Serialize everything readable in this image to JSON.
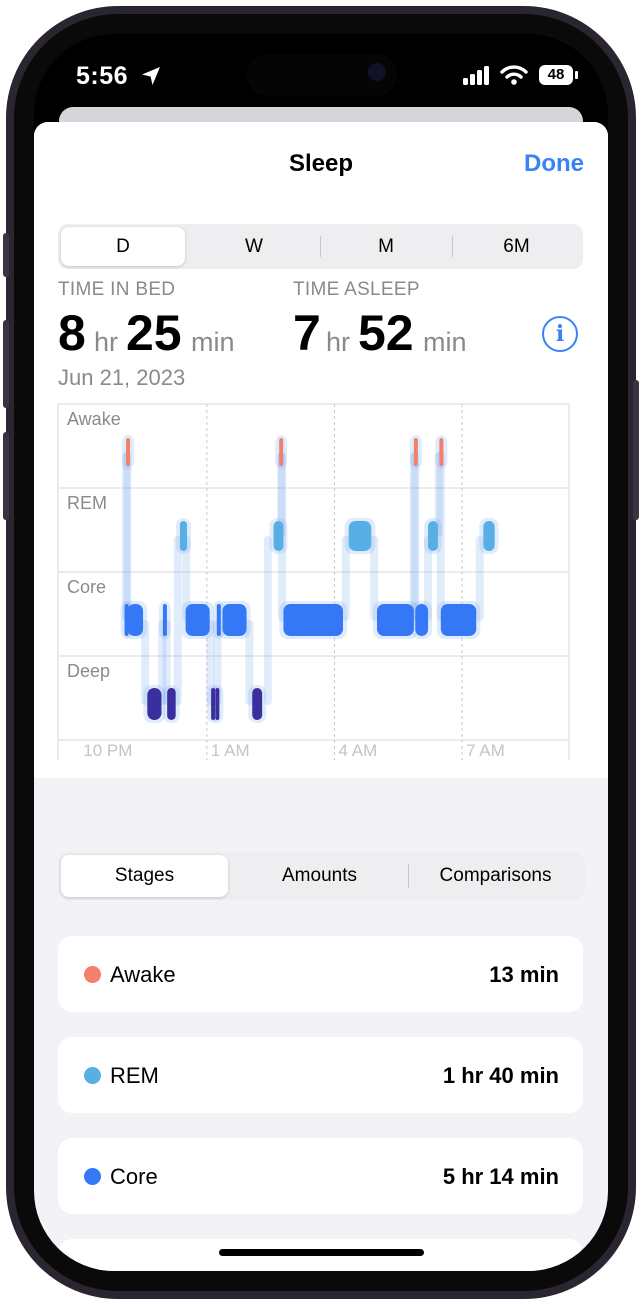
{
  "status_bar": {
    "time": "5:56",
    "battery": "48"
  },
  "header": {
    "title": "Sleep",
    "done_label": "Done"
  },
  "range_tabs": [
    {
      "label": "D",
      "selected": true
    },
    {
      "label": "W",
      "selected": false
    },
    {
      "label": "M",
      "selected": false
    },
    {
      "label": "6M",
      "selected": false
    }
  ],
  "summary": {
    "time_in_bed": {
      "label": "TIME IN BED",
      "hours": "8",
      "hr_unit": "hr",
      "minutes": "25",
      "min_unit": "min"
    },
    "time_asleep": {
      "label": "TIME ASLEEP",
      "hours": "7",
      "hr_unit": "hr",
      "minutes": "52",
      "min_unit": "min"
    },
    "date": "Jun 21, 2023"
  },
  "chart_data": {
    "type": "hypnogram",
    "stages": [
      "Awake",
      "REM",
      "Core",
      "Deep"
    ],
    "x_ticks": [
      "10 PM",
      "1 AM",
      "4 AM",
      "7 AM"
    ],
    "stage_colors": {
      "Awake": "#f2806c",
      "REM": "#5aaee6",
      "Core": "#3478f6",
      "Deep": "#3a2f9e"
    },
    "segments": [
      {
        "stage": "Awake",
        "start": "11:06 PM",
        "end": "11:08 PM"
      },
      {
        "stage": "Core",
        "start": "11:04 PM",
        "end": "11:06 PM"
      },
      {
        "stage": "Core",
        "start": "11:08 PM",
        "end": "11:30 PM"
      },
      {
        "stage": "Deep",
        "start": "11:36 PM",
        "end": "11:56 PM"
      },
      {
        "stage": "Core",
        "start": "11:58 PM",
        "end": "12:02 AM"
      },
      {
        "stage": "Deep",
        "start": "12:04 AM",
        "end": "12:16 AM"
      },
      {
        "stage": "REM",
        "start": "12:22 AM",
        "end": "12:32 AM"
      },
      {
        "stage": "Core",
        "start": "12:30 AM",
        "end": "1:04 AM"
      },
      {
        "stage": "Deep",
        "start": "1:06 AM",
        "end": "1:10 AM"
      },
      {
        "stage": "Deep",
        "start": "1:12 AM",
        "end": "1:16 AM"
      },
      {
        "stage": "Core",
        "start": "1:14 AM",
        "end": "1:18 AM"
      },
      {
        "stage": "Core",
        "start": "1:22 AM",
        "end": "1:56 AM"
      },
      {
        "stage": "Deep",
        "start": "2:04 AM",
        "end": "2:18 AM"
      },
      {
        "stage": "REM",
        "start": "2:34 AM",
        "end": "2:48 AM"
      },
      {
        "stage": "Awake",
        "start": "2:42 AM",
        "end": "2:44 AM"
      },
      {
        "stage": "Core",
        "start": "2:48 AM",
        "end": "4:12 AM"
      },
      {
        "stage": "REM",
        "start": "4:20 AM",
        "end": "4:52 AM"
      },
      {
        "stage": "Core",
        "start": "5:00 AM",
        "end": "5:52 AM"
      },
      {
        "stage": "Awake",
        "start": "5:52 AM",
        "end": "5:54 AM"
      },
      {
        "stage": "Core",
        "start": "5:54 AM",
        "end": "6:12 AM"
      },
      {
        "stage": "REM",
        "start": "6:12 AM",
        "end": "6:26 AM"
      },
      {
        "stage": "Awake",
        "start": "6:28 AM",
        "end": "6:30 AM"
      },
      {
        "stage": "Core",
        "start": "6:30 AM",
        "end": "7:20 AM"
      },
      {
        "stage": "REM",
        "start": "7:30 AM",
        "end": "7:46 AM"
      }
    ]
  },
  "view_tabs": [
    {
      "label": "Stages",
      "selected": true
    },
    {
      "label": "Amounts",
      "selected": false
    },
    {
      "label": "Comparisons",
      "selected": false
    }
  ],
  "stage_summary": [
    {
      "name": "Awake",
      "value": "13 min",
      "color": "#f2806c"
    },
    {
      "name": "REM",
      "value": "1 hr 40 min",
      "color": "#5aaee6"
    },
    {
      "name": "Core",
      "value": "5 hr 14 min",
      "color": "#3478f6"
    }
  ]
}
